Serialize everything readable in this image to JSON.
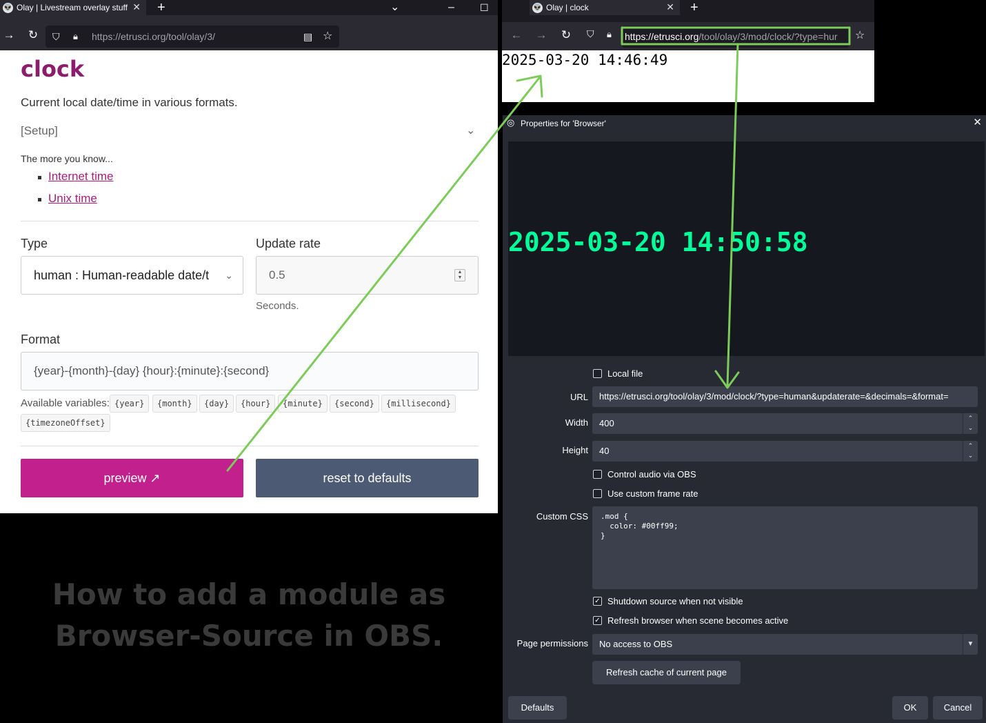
{
  "left_browser": {
    "tab_title": "Olay | Livestream overlay stuff",
    "url_host": "https://etrusci.org",
    "url_path": "/tool/olay/3/",
    "icons": [
      "forward-icon",
      "reload-icon",
      "shield-icon",
      "lock-icon",
      "reader-icon",
      "star-icon",
      "plus-icon",
      "chevron-down-icon",
      "minimize-icon",
      "maximize-icon"
    ]
  },
  "page": {
    "title": "clock",
    "description": "Current local date/time in various formats.",
    "setup_label": "[Setup]",
    "know_more": "The more you know...",
    "links": [
      "Internet time",
      "Unix time"
    ],
    "type_label": "Type",
    "type_value": "human : Human-readable date/t",
    "update_label": "Update rate",
    "update_value": "0.5",
    "seconds_hint": "Seconds.",
    "format_label": "Format",
    "format_value": "{year}-{month}-{day} {hour}:{minute}:{second}",
    "available_label": "Available variables:",
    "variables": [
      "{year}",
      "{month}",
      "{day}",
      "{hour}",
      "{minute}",
      "{second}",
      "{millisecond}",
      "{timezoneOffset}"
    ],
    "preview_button": "preview ↗",
    "reset_button": "reset to defaults"
  },
  "headline": {
    "line1": "How to add a module as",
    "line2": "Browser-Source in OBS."
  },
  "right_browser": {
    "tab_title": "Olay | clock",
    "url_host": "https://etrusci.org",
    "url_path": "/tool/olay/3/mod/clock/?type=hur",
    "output": "2025-03-20 14:46:49"
  },
  "obs": {
    "title": "Properties for 'Browser'",
    "preview_clock": "2025-03-20 14:50:58",
    "local_file": "Local file",
    "local_file_checked": false,
    "url_label": "URL",
    "url_value": "https://etrusci.org/tool/olay/3/mod/clock/?type=human&updaterate=&decimals=&format=",
    "width_label": "Width",
    "width_value": "400",
    "height_label": "Height",
    "height_value": "40",
    "control_audio": "Control audio via OBS",
    "control_audio_checked": false,
    "custom_fps": "Use custom frame rate",
    "custom_fps_checked": false,
    "css_label": "Custom CSS",
    "css_value": ".mod {\n  color: #00ff99;\n}",
    "shutdown": "Shutdown source when not visible",
    "shutdown_checked": true,
    "refresh": "Refresh browser when scene becomes active",
    "refresh_checked": true,
    "permissions_label": "Page permissions",
    "permissions_value": "No access to OBS",
    "refresh_cache_button": "Refresh cache of current page",
    "defaults_button": "Defaults",
    "ok_button": "OK",
    "cancel_button": "Cancel"
  },
  "colors": {
    "brand": "#c2218d",
    "reset_btn": "#4c5a73",
    "clock_green": "#00ff99",
    "annotation": "#7dcc5b"
  }
}
